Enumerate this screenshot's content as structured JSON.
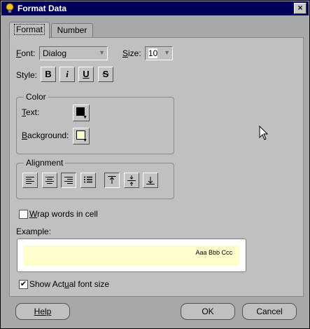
{
  "window": {
    "title": "Format Data",
    "close_label": "×"
  },
  "tabs": [
    {
      "label": "Format",
      "active": true
    },
    {
      "label": "Number",
      "active": false
    }
  ],
  "font": {
    "label_prefix": "F",
    "label_rest": "ont:",
    "value": "Dialog"
  },
  "size": {
    "label_prefix": "S",
    "label_rest": "ize:",
    "value": "10"
  },
  "style": {
    "label": "Style:",
    "buttons": [
      {
        "name": "bold",
        "glyph": "B"
      },
      {
        "name": "italic",
        "glyph": "i"
      },
      {
        "name": "underline",
        "glyph": "U"
      },
      {
        "name": "strikethrough",
        "glyph": "S"
      }
    ]
  },
  "color": {
    "legend": "Color",
    "text_label_prefix": "T",
    "text_label_rest": "ext:",
    "text_color": "#000000",
    "background_label_prefix": "B",
    "background_label_rest": "ackground:",
    "background_color": "#ffffcc"
  },
  "alignment": {
    "legend": "Alignment",
    "horizontal": [
      "align-left",
      "align-center",
      "align-right",
      "justify"
    ],
    "vertical": [
      "align-top",
      "align-middle",
      "align-bottom"
    ]
  },
  "wrap": {
    "label_prefix": "W",
    "label_rest": "rap words in cell",
    "checked": false
  },
  "example": {
    "label": "Example:",
    "sample_text": "Aaa Bbb Ccc"
  },
  "show_actual": {
    "label_before": "Show Act",
    "label_u": "u",
    "label_after": "al font size",
    "checked": true,
    "check_glyph": "✔"
  },
  "buttons": {
    "help": "Help",
    "ok": "OK",
    "cancel": "Cancel"
  }
}
